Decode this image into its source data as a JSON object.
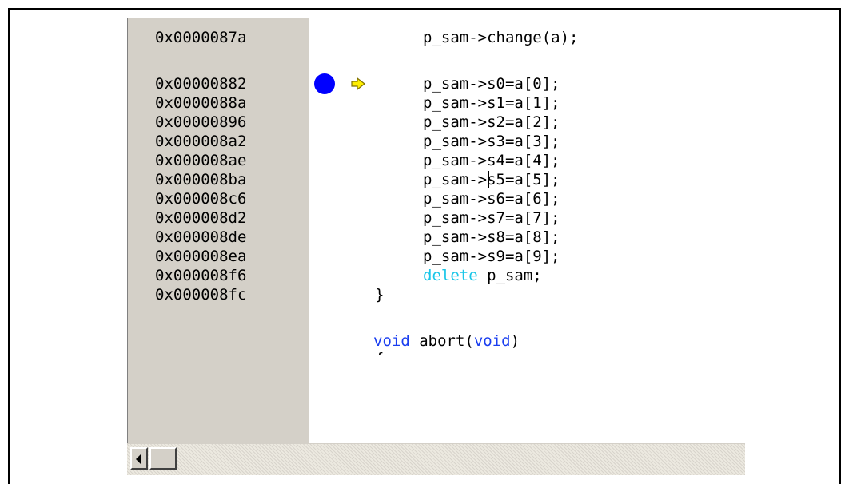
{
  "addresses": [
    "0x0000087a",
    "0x00000882",
    "0x0000088a",
    "0x00000896",
    "0x000008a2",
    "0x000008ae",
    "0x000008ba",
    "0x000008c6",
    "0x000008d2",
    "0x000008de",
    "0x000008ea",
    "0x000008f6",
    "0x000008fc"
  ],
  "source": {
    "line_change": "p_sam->change(a);",
    "assignments": [
      "p_sam->s0=a[0];",
      "p_sam->s1=a[1];",
      "p_sam->s2=a[2];",
      "p_sam->s3=a[3];",
      "p_sam->s4=a[4];",
      "p_sam->s5=a[5];",
      "p_sam->s6=a[6];",
      "p_sam->s7=a[7];",
      "p_sam->s8=a[8];",
      "p_sam->s9=a[9];"
    ],
    "delete_keyword": "delete",
    "delete_rest": " p_sam;",
    "closing_brace": "}",
    "void_keyword_1": "void",
    "abort_text": " abort(",
    "void_keyword_2": "void",
    "close_paren": ")",
    "open_brace_partial": "{"
  },
  "breakpoint": {
    "color": "#0000ff",
    "line": "0x00000882"
  },
  "program_counter": {
    "icon": "yellow-arrow-icon",
    "color": "#ffee00"
  },
  "colors": {
    "keyword_blue": "#1a3ef0",
    "keyword_cyan": "#19c6e8",
    "gutter_gray": "#d4d0c8"
  }
}
